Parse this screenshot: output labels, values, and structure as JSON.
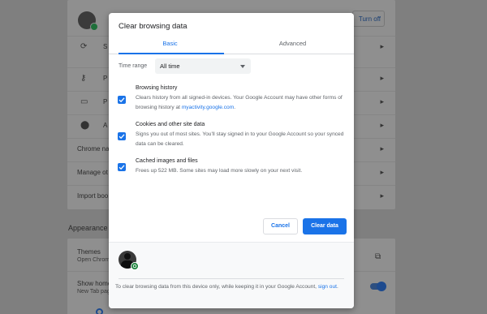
{
  "background": {
    "sync_button": "Turn off",
    "rows": [
      {
        "label": "S",
        "icon": "sync-icon"
      },
      {
        "label": "P",
        "icon": "key-icon"
      },
      {
        "label": "P",
        "icon": "credit-card-icon"
      },
      {
        "label": "A",
        "icon": "location-icon"
      },
      {
        "label": "Chrome na",
        "icon": ""
      },
      {
        "label": "Manage ot",
        "icon": ""
      },
      {
        "label": "Import boo",
        "icon": ""
      }
    ],
    "appearance_heading": "Appearance",
    "themes_label": "Themes",
    "themes_sub": "Open Chrom",
    "show_home_label": "Show home",
    "show_home_sub": "New Tab page"
  },
  "dialog": {
    "title": "Clear browsing data",
    "tabs": [
      {
        "label": "Basic",
        "active": true
      },
      {
        "label": "Advanced",
        "active": false
      }
    ],
    "time_range": {
      "label": "Time range",
      "value": "All time"
    },
    "options": [
      {
        "title": "Browsing history",
        "desc": "Clears history from all signed-in devices. Your Google Account may have other forms of browsing history at ",
        "link": "myactivity.google.com",
        "desc_after": ".",
        "checked": true
      },
      {
        "title": "Cookies and other site data",
        "desc": "Signs you out of most sites. You'll stay signed in to your Google Account so your synced data can be cleared.",
        "checked": true
      },
      {
        "title": "Cached images and files",
        "desc": "Frees up 522 MB. Some sites may load more slowly on your next visit.",
        "checked": true
      }
    ],
    "cancel_label": "Cancel",
    "clear_label": "Clear data",
    "footer": {
      "text": "To clear browsing data from this device only, while keeping it in your Google Account, ",
      "link": "sign out",
      "text_after": "."
    }
  },
  "colors": {
    "accent": "#1a73e8",
    "badge": "#188038"
  }
}
